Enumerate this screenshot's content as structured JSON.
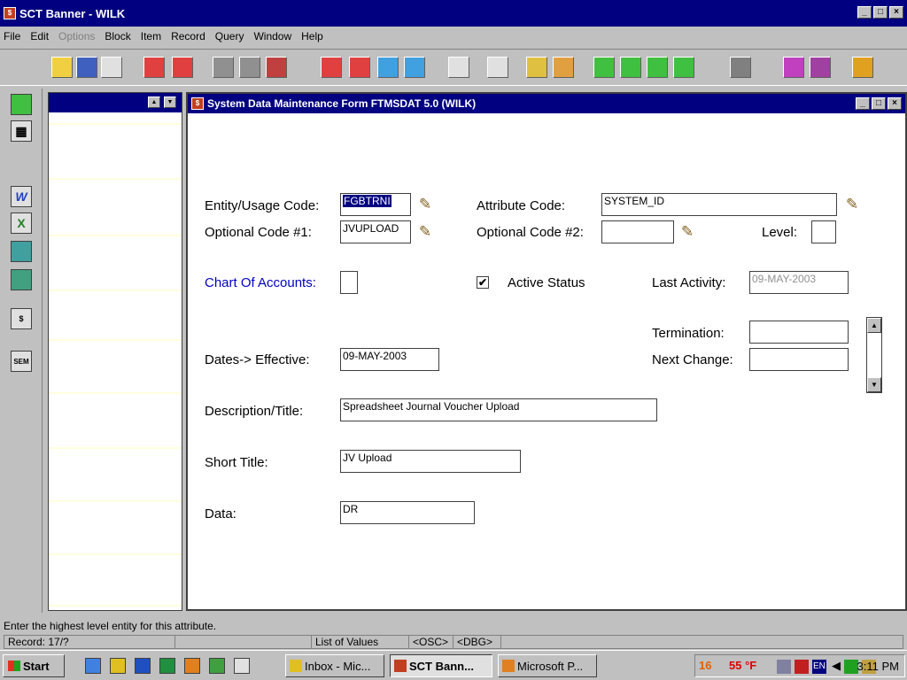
{
  "window": {
    "title": "SCT Banner - WILK",
    "app_icon": "banner-icon"
  },
  "menu": [
    "File",
    "Edit",
    "Options",
    "Block",
    "Item",
    "Record",
    "Query",
    "Window",
    "Help"
  ],
  "form": {
    "title": "System Data Maintenance Form  FTMSDAT  5.0  (WILK)",
    "labels": {
      "entity": "Entity/Usage Code:",
      "attribute": "Attribute Code:",
      "opt1": "Optional Code #1:",
      "opt2": "Optional Code #2:",
      "level": "Level:",
      "coa": "Chart Of Accounts:",
      "active": "Active Status",
      "last_activity": "Last Activity:",
      "termination": "Termination:",
      "dates_effective": "Dates-> Effective:",
      "next_change": "Next Change:",
      "description": "Description/Title:",
      "short_title": "Short Title:",
      "data": "Data:"
    },
    "values": {
      "entity": "FGBTRNI",
      "attribute": "SYSTEM_ID",
      "opt1": "JVUPLOAD",
      "opt2": "",
      "level": "",
      "coa": "",
      "active_checked": "✔",
      "last_activity": "09-MAY-2003",
      "termination": "",
      "effective": "09-MAY-2003",
      "next_change": "",
      "description": "Spreadsheet Journal Voucher Upload",
      "short_title": "JV Upload",
      "data": "DR"
    },
    "colors": {
      "coa_label": "#0000c0",
      "title_bar": "#000080"
    }
  },
  "status": {
    "hint": "Enter the highest level entity for this attribute.",
    "record": "Record: 17/?",
    "lov": "List of Values",
    "osc": "<OSC>",
    "dbg": "<DBG>"
  },
  "taskbar": {
    "start": "Start",
    "tasks": [
      "Inbox - Mic...",
      "SCT Bann...",
      "Microsoft P..."
    ],
    "temp_num": "16",
    "temp": "55 °F",
    "lang": "EN",
    "clock": "3:11 PM"
  }
}
